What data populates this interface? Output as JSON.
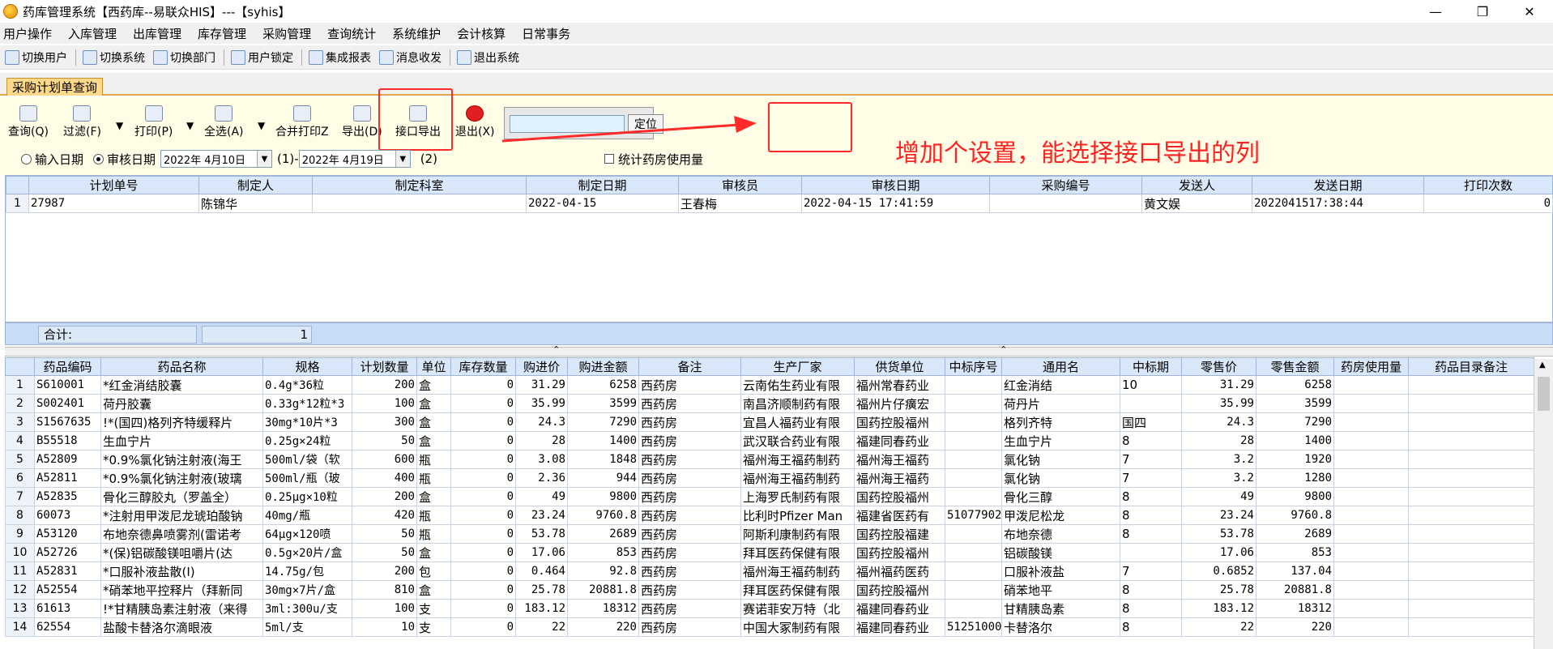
{
  "window": {
    "title": "药库管理系统【西药库--易联众HIS】---【syhis】",
    "minimize": "—",
    "restore": "❐",
    "close": "✕"
  },
  "menu": [
    "用户操作",
    "入库管理",
    "出库管理",
    "库存管理",
    "采购管理",
    "查询统计",
    "系统维护",
    "会计核算",
    "日常事务"
  ],
  "toolbar": [
    "切换用户",
    "切换系统",
    "切换部门",
    "用户锁定",
    "集成报表",
    "消息收发",
    "退出系统"
  ],
  "tab": "采购计划单查询",
  "panel": {
    "query": "查询(Q)",
    "filter": "过滤(F)",
    "print": "打印(P)",
    "selectall": "全选(A)",
    "mergeprint": "合并打印Z",
    "export": "导出(D)",
    "iface_export": "接口导出",
    "exit": "退出(X)",
    "locate": "定位",
    "search_value": ""
  },
  "annotation": "增加个设置，能选择接口导出的列",
  "filter": {
    "input_date": "输入日期",
    "audit_date": "审核日期",
    "date1": "2022年 4月10日",
    "mark1": "(1)",
    "dash": "-",
    "date2": "2022年 4月19日",
    "mark2": "(2)",
    "pharmacy_usage": "统计药房使用量"
  },
  "plan_table": {
    "headers": [
      "计划单号",
      "制定人",
      "制定科室",
      "制定日期",
      "审核员",
      "审核日期",
      "采购编号",
      "发送人",
      "发送日期",
      "打印次数"
    ],
    "rows": [
      [
        "1",
        "27987",
        "陈锦华",
        "",
        "2022-04-15",
        "王春梅",
        "2022-04-15 17:41:59",
        "",
        "黄文娱",
        "2022041517:38:44",
        "0"
      ]
    ]
  },
  "summary": {
    "label": "合计:",
    "value": "1"
  },
  "detail_table": {
    "headers": [
      "药品编码",
      "药品名称",
      "规格",
      "计划数量",
      "单位",
      "库存数量",
      "购进价",
      "购进金额",
      "备注",
      "生产厂家",
      "供货单位",
      "中标序号",
      "通用名",
      "中标期",
      "零售价",
      "零售金额",
      "药房使用量",
      "药品目录备注"
    ],
    "rows": [
      [
        "1",
        "S610001",
        "*红金消结胶囊",
        "0.4g*36粒",
        "200",
        "盒",
        "0",
        "31.29",
        "6258",
        "西药房",
        "云南佑生药业有限",
        "福州常春药业",
        "",
        "红金消结",
        "10",
        "31.29",
        "6258",
        "",
        ""
      ],
      [
        "2",
        "S002401",
        "荷丹胶囊",
        "0.33g*12粒*3",
        "100",
        "盒",
        "0",
        "35.99",
        "3599",
        "西药房",
        "南昌济顺制药有限",
        "福州片仔癀宏",
        "",
        "荷丹片",
        "",
        "35.99",
        "3599",
        "",
        ""
      ],
      [
        "3",
        "S1567635",
        "!*(国四)格列齐特缓释片",
        "30mg*10片*3",
        "300",
        "盒",
        "0",
        "24.3",
        "7290",
        "西药房",
        "宜昌人福药业有限",
        "国药控股福州",
        "",
        "格列齐特",
        "国四",
        "24.3",
        "7290",
        "",
        ""
      ],
      [
        "4",
        "B55518",
        "生血宁片",
        "0.25g×24粒",
        "50",
        "盒",
        "0",
        "28",
        "1400",
        "西药房",
        "武汉联合药业有限",
        "福建同春药业",
        "",
        "生血宁片",
        "8",
        "28",
        "1400",
        "",
        ""
      ],
      [
        "5",
        "A52809",
        "*0.9%氯化钠注射液(海王",
        "500ml/袋（软",
        "600",
        "瓶",
        "0",
        "3.08",
        "1848",
        "西药房",
        "福州海王福药制药",
        "福州海王福药",
        "",
        "氯化钠",
        "7",
        "3.2",
        "1920",
        "",
        ""
      ],
      [
        "6",
        "A52811",
        "*0.9%氯化钠注射液(玻璃",
        "500ml/瓶（玻",
        "400",
        "瓶",
        "0",
        "2.36",
        "944",
        "西药房",
        "福州海王福药制药",
        "福州海王福药",
        "",
        "氯化钠",
        "7",
        "3.2",
        "1280",
        "",
        ""
      ],
      [
        "7",
        "A52835",
        "骨化三醇胶丸（罗盖全）",
        "0.25μg×10粒",
        "200",
        "盒",
        "0",
        "49",
        "9800",
        "西药房",
        "上海罗氏制药有限",
        "国药控股福州",
        "",
        "骨化三醇",
        "8",
        "49",
        "9800",
        "",
        ""
      ],
      [
        "8",
        "60073",
        "*注射用甲泼尼龙琥珀酸钠",
        "40mg/瓶",
        "420",
        "瓶",
        "0",
        "23.24",
        "9760.8",
        "西药房",
        "比利时Pfizer Man",
        "福建省医药有",
        "51077902",
        "甲泼尼松龙",
        "8",
        "23.24",
        "9760.8",
        "",
        ""
      ],
      [
        "9",
        "A53120",
        "布地奈德鼻喷雾剂(雷诺考",
        "64μg×120喷",
        "50",
        "瓶",
        "0",
        "53.78",
        "2689",
        "西药房",
        "阿斯利康制药有限",
        "国药控股福建",
        "",
        "布地奈德",
        "8",
        "53.78",
        "2689",
        "",
        ""
      ],
      [
        "10",
        "A52726",
        "*(保)铝碳酸镁咀嚼片(达",
        "0.5g×20片/盒",
        "50",
        "盒",
        "0",
        "17.06",
        "853",
        "西药房",
        "拜耳医药保健有限",
        "国药控股福州",
        "",
        "铝碳酸镁",
        "",
        "17.06",
        "853",
        "",
        ""
      ],
      [
        "11",
        "A52831",
        "*口服补液盐散(Ⅰ)",
        "14.75g/包",
        "200",
        "包",
        "0",
        "0.464",
        "92.8",
        "西药房",
        "福州海王福药制药",
        "福州福药医药",
        "",
        "口服补液盐",
        "7",
        "0.6852",
        "137.04",
        "",
        ""
      ],
      [
        "12",
        "A52554",
        "*硝苯地平控释片（拜新同",
        "30mg×7片/盒",
        "810",
        "盒",
        "0",
        "25.78",
        "20881.8",
        "西药房",
        "拜耳医药保健有限",
        "国药控股福州",
        "",
        "硝苯地平",
        "8",
        "25.78",
        "20881.8",
        "",
        ""
      ],
      [
        "13",
        "61613",
        "!*甘精胰岛素注射液（来得",
        "3ml:300u/支",
        "100",
        "支",
        "0",
        "183.12",
        "18312",
        "西药房",
        "赛诺菲安万特（北",
        "福建同春药业",
        "",
        "甘精胰岛素",
        "8",
        "183.12",
        "18312",
        "",
        ""
      ],
      [
        "14",
        "62554",
        "盐酸卡替洛尔滴眼液",
        "5ml/支",
        "10",
        "支",
        "0",
        "22",
        "220",
        "西药房",
        "中国大冢制药有限",
        "福建同春药业",
        "51251000",
        "卡替洛尔",
        "8",
        "22",
        "220",
        "",
        ""
      ]
    ]
  },
  "colors": {
    "annotation": "#ff2222",
    "header": "#d8e7f9",
    "panel": "#fffde6",
    "tab": "#ffd889"
  }
}
